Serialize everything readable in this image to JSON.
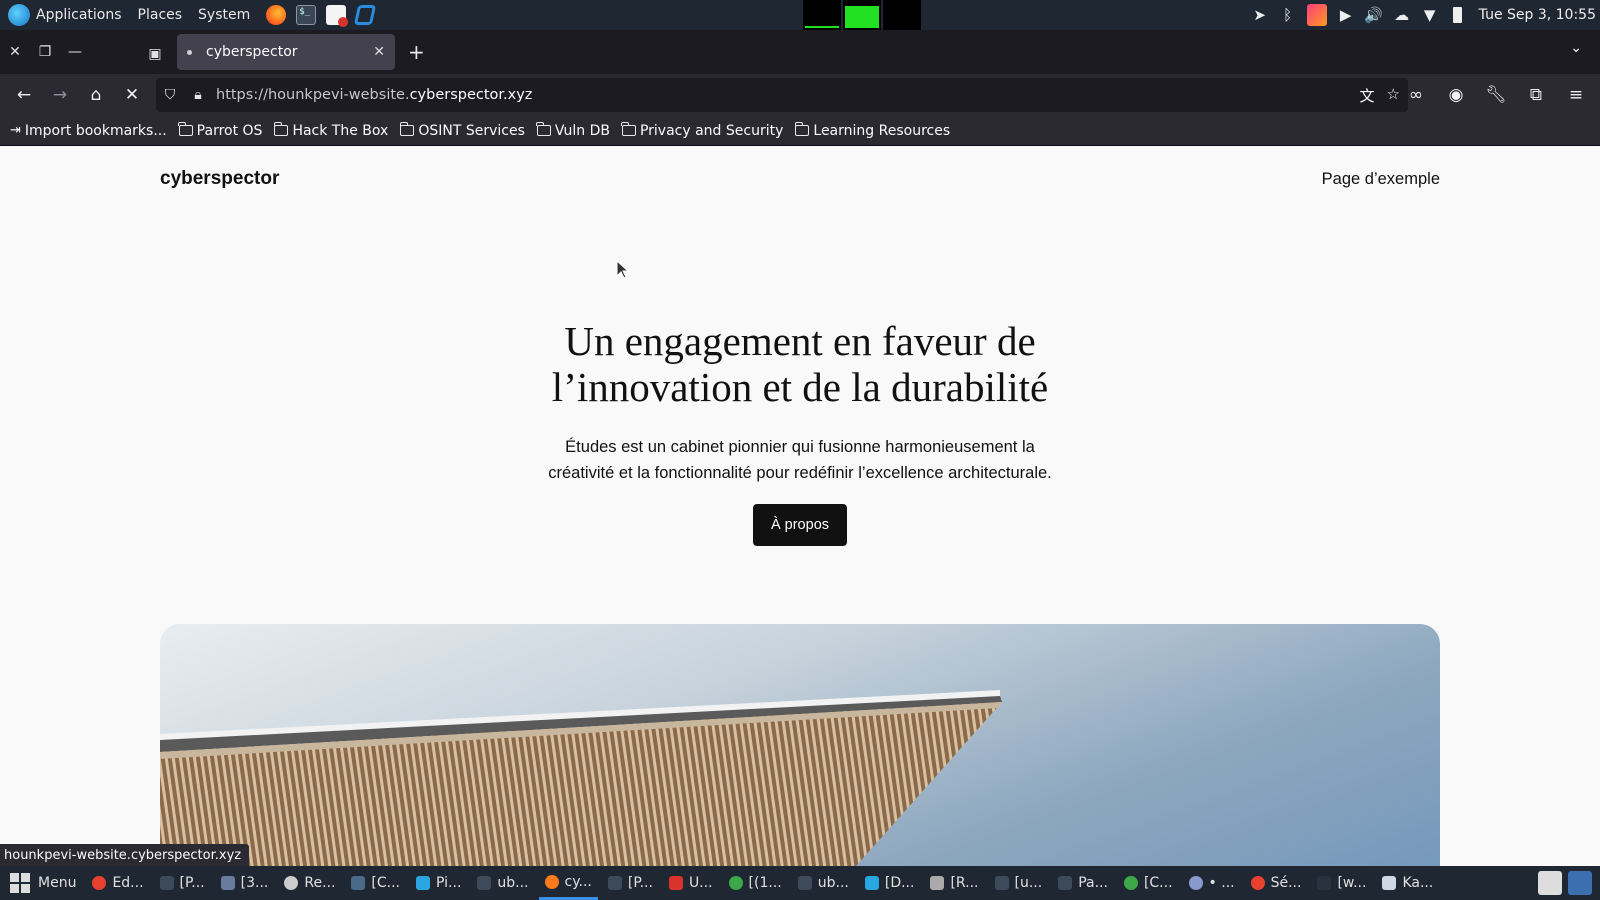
{
  "system_panel": {
    "menus": [
      "Applications",
      "Places",
      "System"
    ],
    "clock": "Tue Sep 3, 10:55",
    "launchers": [
      "firefox-icon",
      "terminal-icon",
      "document-icon",
      "vscode-icon"
    ],
    "tray_icons": [
      "send-icon",
      "bluetooth-icon",
      "app-icon",
      "camera-icon",
      "volume-icon",
      "cloud-icon",
      "wifi-icon",
      "battery-icon"
    ]
  },
  "browser": {
    "tab": {
      "title": "cyberspector"
    },
    "url": {
      "prefix": "https://hounkpevi-website.",
      "domain": "cyberspector.xyz"
    },
    "bookmarks": [
      "Import bookmarks...",
      "Parrot OS",
      "Hack The Box",
      "OSINT Services",
      "Vuln DB",
      "Privacy and Security",
      "Learning Resources"
    ],
    "status_url": "hounkpevi-website.cyberspector.xyz"
  },
  "site": {
    "title": "cyberspector",
    "nav_link": "Page d’exemple",
    "hero_title_line1": "Un engagement en faveur de",
    "hero_title_line2": "l’innovation et de la durabilité",
    "hero_text_line1": "Études est un cabinet pionnier qui fusionne harmonieusement la",
    "hero_text_line2": "créativité et la fonctionnalité pour redéfinir l’excellence architecturale.",
    "hero_button": "À propos"
  },
  "taskbar": {
    "menu_label": "Menu",
    "items": [
      "Ed...",
      "[P...",
      "[3...",
      "Re...",
      "[C...",
      "Pi...",
      "ub...",
      "cy...",
      "[P...",
      "U...",
      "[(1...",
      "ub...",
      "[D...",
      "[R...",
      "[u...",
      "Pa...",
      "[C...",
      "• ...",
      "Sé...",
      "[w...",
      "Ka..."
    ],
    "active_index": 7
  }
}
